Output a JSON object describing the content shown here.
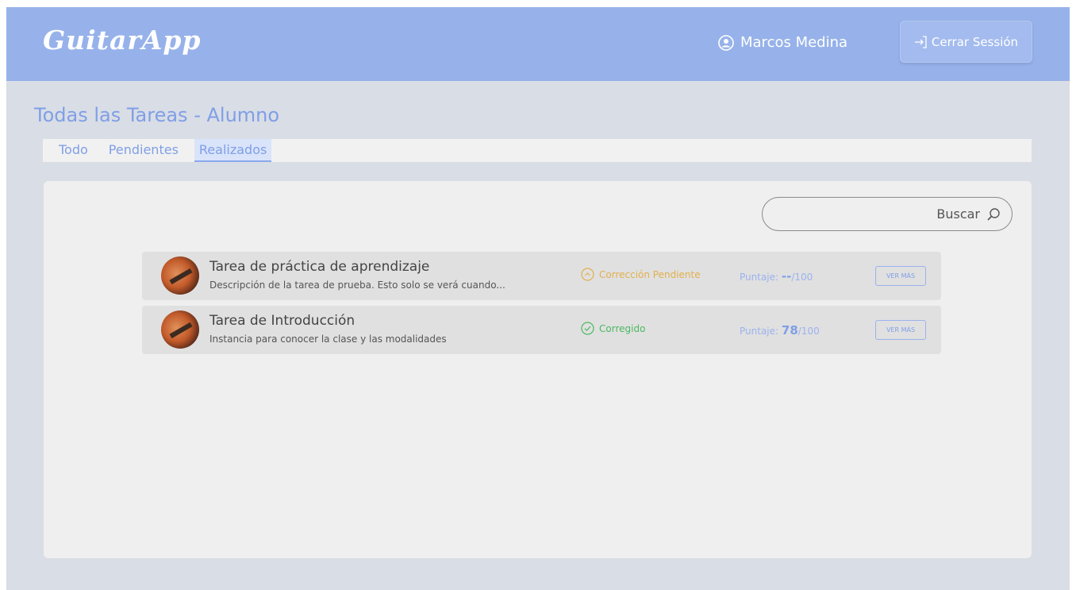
{
  "header": {
    "logo": "GuitarApp",
    "user_name": "Marcos Medina",
    "logout_label": "Cerrar Sessión"
  },
  "page": {
    "title": "Todas las Tareas - Alumno"
  },
  "tabs": [
    {
      "label": "Todo",
      "active": false
    },
    {
      "label": "Pendientes",
      "active": false
    },
    {
      "label": "Realizados",
      "active": true
    }
  ],
  "search": {
    "placeholder": "Buscar"
  },
  "tasks": [
    {
      "title": "Tarea de práctica de aprendizaje",
      "description": "Descripción de la tarea de prueba. Esto solo se verá cuando...",
      "status": "Corrección Pendiente",
      "status_color": "#e2b04c",
      "status_icon": "chevron-up-circle-icon",
      "score_label": "Puntaje:",
      "score_value": "--",
      "score_max": "/100",
      "more_label": "VER MÁS"
    },
    {
      "title": "Tarea de Introducción",
      "description": "Instancia para conocer la clase y las modalidades",
      "status": "Corregido",
      "status_color": "#4cb860",
      "status_icon": "check-circle-icon",
      "score_label": "Puntaje:",
      "score_value": "78",
      "score_max": "/100",
      "more_label": "VER MÁS"
    }
  ],
  "colors": {
    "header_bg": "#97b2ea",
    "accent": "#7f9fe6",
    "page_bg": "#d9dde5",
    "panel_bg": "#efefef"
  }
}
